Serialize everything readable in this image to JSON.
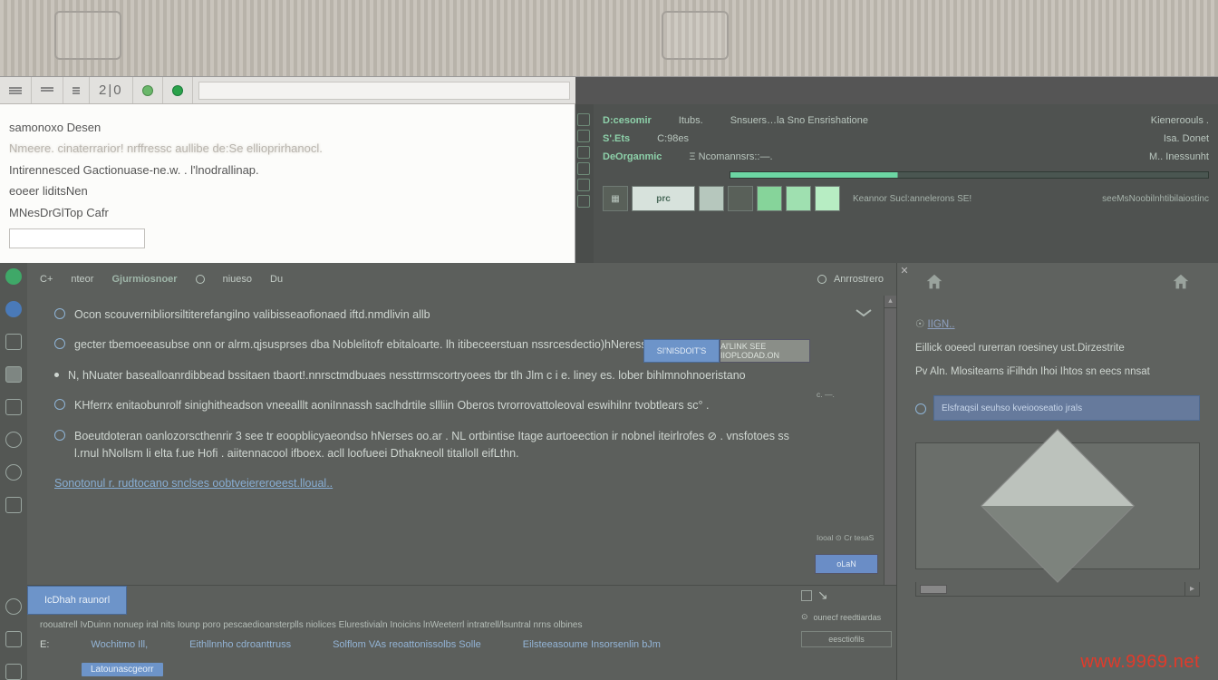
{
  "toolbar": {
    "number_display": "2|0",
    "address_value": ""
  },
  "notepad": {
    "lines": [
      "samonoxo Desen",
      "Nmeere. cinaterrarior! nrffressc        aullibe de:Se ellioprirhanocl.",
      "Intirennesced Gactionuase-ne.w.  .    l'lnodrallinap.",
      "eoeer liditsNen",
      "MNesDrGlTop Cafr"
    ],
    "input_value": ""
  },
  "ide": {
    "rows": [
      {
        "label": "D:cesomir",
        "mid": "Itubs.",
        "right": "Snsuers…la Sno Ensrishatione",
        "far": "Kieneroouls ."
      },
      {
        "label": "S'.Ets",
        "mid": "C:98es",
        "right": "",
        "far": "Isa.   Donet"
      },
      {
        "label": "DeOrganmic",
        "mid": "Ξ   Ncomannsrs::—.",
        "right": "",
        "far": "M..   Inessunht"
      }
    ],
    "cell_text": "prc",
    "tail_left": "Keannor  Sucl:annelerons  SE!",
    "tail_right": "seeMsNoobilnhtibilaiostinc"
  },
  "crumbs": {
    "items": [
      "C+",
      "nteor",
      "Gjurmiosnoer",
      "niueso",
      "Du"
    ],
    "right": "Anrrostrero"
  },
  "content": {
    "paragraphs": [
      "Ocon scouvernibliorsiltiterefangilno valibisseaofionaed iftd.nmdlivin allb",
      "gecter tbemoeeasubse onn or alrm.qjsusprses dba Noblelitofr ebitaloarte. lh itibeceerstuan nssrcesdectio)hNeress l.ta.",
      "N, hNuater basealloanrdibbead  bssitaen tbaort!.nnrsctmdbuaes nessttrmscortryoees tbr tlh Jlm c i e. liney es. lober bihlmnohnoeristano",
      "KHferrx enitaobunrolf sinighitheadson vneealllt aoniInnassh saclhdrtile sllliin Oberos tvrorrovattoleoval eswihilnr  tvobtlears    sc° .",
      "Boeutdoteran oanlozorscthenrir 3 see tr eoopblicyaeondso hNerses oo.ar . NL ortbintise Itage aurtoeection ir nobnel iteirlrofes   ⊘ . vnsfotoes ss  l.rnul hNollsm  li elta f.ue   Hofi . aiitennacool     ifboex.   acll loofueei   Dthakneoll titalloll   eifLthn.",
      "Sonotonul r. rudtocano snclses oobtveiereroeest.lloual.."
    ],
    "side_buttons": {
      "a": "SI'NISDOIT'S",
      "b": "Al'LINK  SEE  IIOPLODAD.ON"
    },
    "chevron": true,
    "mini_label_1": "c. —.",
    "mini_label_2": "Iooal  ⊙ Cr tesaS",
    "mini_button": "oLaN"
  },
  "footer": {
    "tab_active": "IcDhah raunorl",
    "desc": "roouatrell IvDuinn nonuep iral nits  Iounp poro pescaedioansterplls niolices Elurestivialn Inoicins lnWeeterrl intratrell/lsuntral nrns olbines",
    "cols": [
      "E:",
      "Wochitmo Ill,",
      "Eithllnnho cdroanttruss",
      "Solflom VAs reoattonissolbs Solle",
      "Eilsteeasoume Insorsenlin bJm"
    ],
    "button": "Latounascgeorr"
  },
  "right_panel": {
    "title": "IIGN..",
    "line1": "Eillick ooeecl rurerran roesiney ust.Dirzestrite",
    "line2": "Pv Aln. Mlositearns iFilhdn Ihoi Ihtos sn eecs nnsat",
    "answer_field": "Elsfraqsil  seuhso kveiooseatio jrals"
  },
  "toolstrip": {
    "row1": "",
    "row2": "ounecf reedtiardas",
    "pill": "eesctiofils"
  },
  "watermark": "www.9969.net"
}
